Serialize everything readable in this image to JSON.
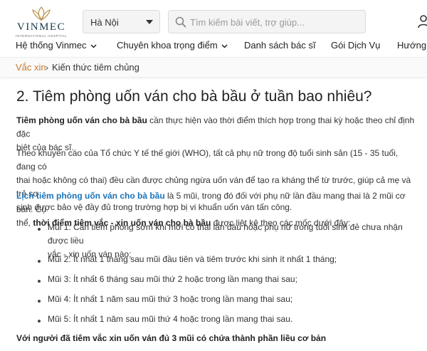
{
  "brand": {
    "logo_text": "VINMEC",
    "logo_sub": "INTERNATIONAL HOSPITAL"
  },
  "header": {
    "city": "Hà Nội",
    "search_placeholder": "Tìm kiếm bài viết, trợ giúp...",
    "user_icon": "user-icon"
  },
  "nav": [
    {
      "label": "Hệ thống Vinmec",
      "dropdown": true
    },
    {
      "label": "Chuyên khoa trọng điểm",
      "dropdown": true
    },
    {
      "label": "Danh sách bác sĩ",
      "dropdown": false
    },
    {
      "label": "Gói Dịch Vụ",
      "dropdown": false
    },
    {
      "label": "Hướng",
      "dropdown": false
    }
  ],
  "breadcrumb": {
    "link": "Vắc xin",
    "separator": "›",
    "current": "Kiến thức tiêm chủng"
  },
  "article": {
    "heading": "2. Tiêm phòng uốn ván cho bà bầu ở tuần bao nhiêu?",
    "p1_bold": "Tiêm phòng uốn ván cho bà bầu",
    "p1_l1": " cần thực hiện vào thời điểm thích hợp trong thai kỳ hoặc theo chỉ định đặc",
    "p1_l2": "biệt của bác sĩ.",
    "p2_l1": "Theo khuyến cáo của Tổ chức Y tế thế giới (WHO), tất cả phụ nữ trong độ tuổi sinh sản (15 - 35 tuổi, đang có",
    "p2_l2": "thai hoặc không có thai) đều cần được chủng ngừa uốn ván để tạo ra kháng thể từ trước, giúp cả mẹ và trẻ sơ",
    "p2_l3": "sinh được bảo vệ đầy đủ trong trường hợp bị vi khuẩn uốn ván tấn công.",
    "p3_link": "Lịch tiêm phòng uốn ván cho bà bầu",
    "p3_l1": " là 5 mũi, trong đó đối với phụ nữ lần đầu mang thai là 2 mũi cơ bản. Cụ",
    "p3_l2a": "thể, ",
    "p3_bold": "thời điểm tiêm vắc - xin uốn ván cho bà bầu",
    "p3_l2b": " được liệt kê theo các mốc dưới đây:",
    "doses": [
      {
        "l1": "Mũi 1: Cần tiêm phòng sớm khi mới có thai lần đầu hoặc phụ nữ trong tuổi sinh đẻ chưa nhận được liều",
        "l2": "vắc - xin uốn ván nào;"
      },
      {
        "l1": "Mũi 2: Ít nhất 1 tháng sau mũi đầu tiên và tiêm trước khi sinh ít nhất 1 tháng;",
        "l2": ""
      },
      {
        "l1": "Mũi 3: Ít nhất 6 tháng sau mũi thứ 2 hoặc trong lần mang thai sau;",
        "l2": ""
      },
      {
        "l1": "Mũi 4: Ít nhất 1 năm sau mũi thứ 3 hoặc trong lần mang thai sau;",
        "l2": ""
      },
      {
        "l1": "Mũi 5: Ít nhất 1 năm sau mũi thứ 4 hoặc trong lần mang thai sau.",
        "l2": ""
      }
    ],
    "p4_bold": "Với người đã tiêm vắc xin uốn ván đủ 3 mũi có chứa thành phần liều cơ bản"
  },
  "colors": {
    "accent_orange": "#c47a2c",
    "link_blue": "#1a73b8",
    "logo_dark": "#1b3a4b"
  }
}
